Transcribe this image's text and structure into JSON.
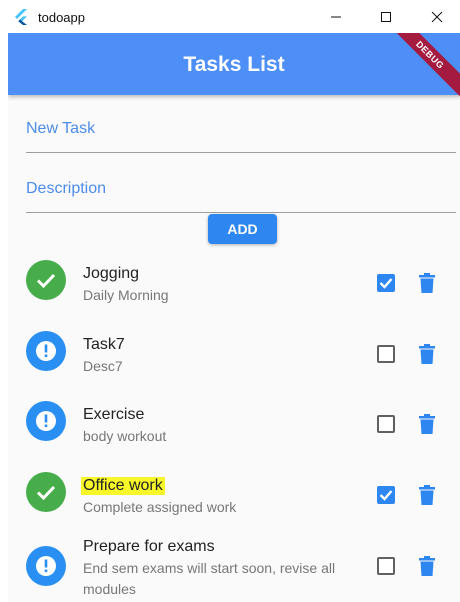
{
  "window": {
    "title": "todoapp"
  },
  "appbar": {
    "title": "Tasks List",
    "debug_banner": "DEBUG",
    "color": "#4e8ef7"
  },
  "form": {
    "task_placeholder": "New Task",
    "description_placeholder": "Description",
    "add_label": "ADD"
  },
  "tasks": [
    {
      "title": "Jogging",
      "description": "Daily Morning",
      "done": true,
      "highlighted": false
    },
    {
      "title": "Task7",
      "description": "Desc7",
      "done": false,
      "highlighted": false
    },
    {
      "title": "Exercise",
      "description": "body workout",
      "done": false,
      "highlighted": false
    },
    {
      "title": "Office work",
      "description": "Complete assigned work",
      "done": true,
      "highlighted": true
    },
    {
      "title": "Prepare for exams",
      "description": "End sem exams will start soon, revise all modules",
      "done": false,
      "highlighted": false
    }
  ],
  "colors": {
    "done": "#47ad4b",
    "pending": "#2a8ff3",
    "accent": "#2e86f0",
    "highlight": "#f7f72a"
  }
}
